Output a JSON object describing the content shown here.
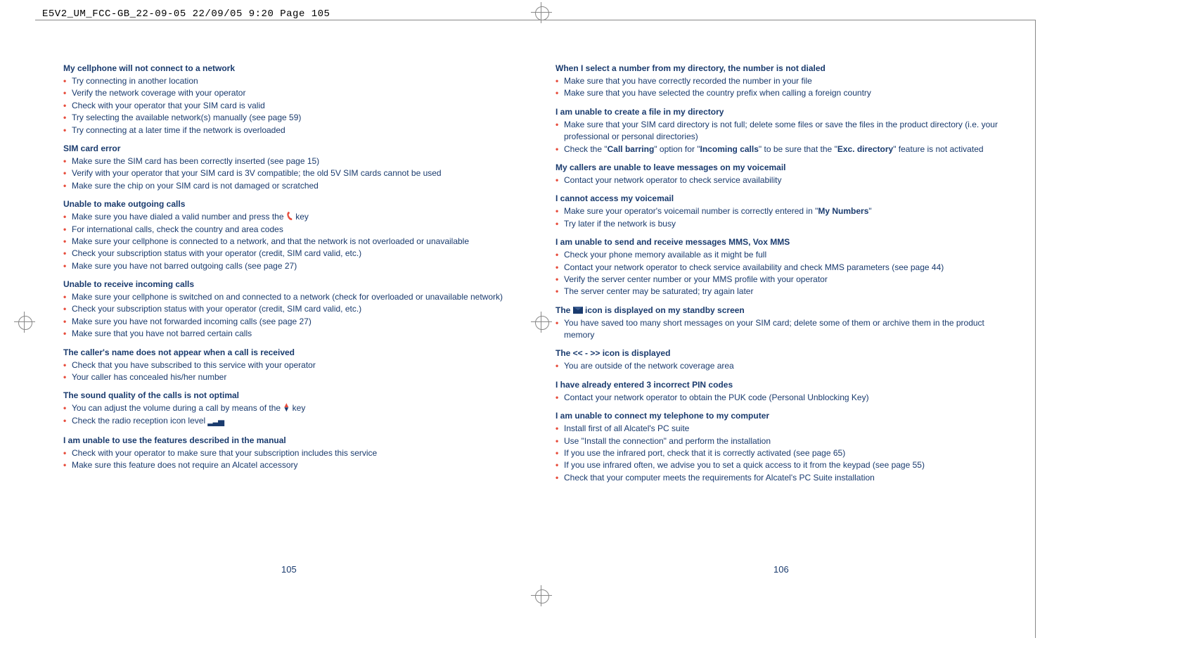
{
  "header": "E5V2_UM_FCC-GB_22-09-05  22/09/05  9:20  Page 105",
  "left_page": {
    "sections": [
      {
        "title": "My cellphone will not connect to a network",
        "items": [
          "Try connecting in another location",
          "Verify the network coverage with your operator",
          "Check with your operator that your SIM card is valid",
          "Try selecting the available network(s) manually (see page 59)",
          "Try connecting at a later time if the network is overloaded"
        ]
      },
      {
        "title": "SIM card error",
        "items": [
          "Make sure the SIM card has been correctly inserted (see page 15)",
          "Verify with your operator that your SIM card is 3V compatible; the old 5V SIM cards cannot be used",
          "Make sure the chip on your SIM card is not damaged or scratched"
        ]
      },
      {
        "title": "Unable to make outgoing calls",
        "items_pre": "Make sure you have dialed a valid number and press the ",
        "items_post": " key",
        "items": [
          "For international calls, check the country and area codes",
          "Make sure your cellphone is connected to a network, and that the network is not overloaded or unavailable",
          "Check your subscription status with your operator (credit, SIM card valid, etc.)",
          "Make sure you have not barred outgoing calls (see page 27)"
        ]
      },
      {
        "title": "Unable to receive incoming calls",
        "items": [
          "Make sure your cellphone is switched on and connected to a network (check for overloaded or unavailable network)",
          "Check your subscription status with your operator (credit, SIM card valid, etc.)",
          "Make sure you have not forwarded incoming calls (see page 27)",
          "Make sure that you have not barred certain calls"
        ]
      },
      {
        "title": "The caller's name does not appear when a call is received",
        "items": [
          "Check that you have subscribed to this service with your operator",
          "Your caller has concealed his/her number"
        ]
      },
      {
        "title": "The sound quality of the calls is not optimal",
        "vol_pre": "You can adjust the volume during a call by means of the ",
        "vol_post": " key",
        "signal_pre": "Check the radio reception icon level  "
      },
      {
        "title": "I am unable to use the features described in the manual",
        "items": [
          "Check with your operator to make sure that your subscription includes this service",
          "Make sure this feature does not require an Alcatel accessory"
        ]
      }
    ],
    "page_number": "105"
  },
  "right_page": {
    "sections": [
      {
        "title": "When I select a number from my directory, the number is not dialed",
        "items": [
          "Make sure that you have correctly recorded the number in your file",
          "Make sure that you have selected the country prefix when calling a foreign country"
        ]
      },
      {
        "title": "I am unable to create a file in my directory",
        "items_html": [
          "Make sure that your SIM card directory is not full; delete some files or save the files in the product directory (i.e. your professional or personal directories)",
          "Check the \"<b>Call barring</b>\" option for \"<b>Incoming calls</b>\" to be sure that the \"<b>Exc. directory</b>\" feature is not activated"
        ]
      },
      {
        "title": "My callers are unable to leave messages on my voicemail",
        "items": [
          "Contact your network operator to check service availability"
        ]
      },
      {
        "title": "I cannot access my voicemail",
        "items_html": [
          "Make sure your operator's voicemail number is correctly entered in \"<b>My Numbers</b>\"",
          "Try later if the network is busy"
        ]
      },
      {
        "title": "I am unable to send and receive messages MMS, Vox MMS",
        "items": [
          "Check your phone memory available as it might be full",
          "Contact your network operator to check service availability and check MMS parameters (see page 44)",
          "Verify the server center number or your MMS profile with your operator",
          "The server center may be saturated; try again later"
        ]
      },
      {
        "msg_title_pre": "The ",
        "msg_title_post": " icon is displayed on my standby screen",
        "items": [
          "You have saved too many short messages on your SIM card; delete some of them or archive them in the product memory"
        ]
      },
      {
        "title": "The << - >> icon is displayed",
        "items": [
          "You are outside of the network coverage area"
        ]
      },
      {
        "title": "I have already entered 3 incorrect PIN codes",
        "items": [
          "Contact your network operator to obtain the PUK code (Personal Unblocking Key)"
        ]
      },
      {
        "title": "I am unable to connect my telephone to my computer",
        "items": [
          "Install first of all Alcatel's PC suite",
          "Use \"Install the connection\" and perform the installation",
          "If you use the infrared port, check that it is correctly activated (see page 65)",
          "If you use infrared often, we advise you to set a quick access to it from the keypad (see page 55)",
          "Check that your computer meets the requirements for Alcatel's PC Suite installation"
        ]
      }
    ],
    "page_number": "106"
  }
}
